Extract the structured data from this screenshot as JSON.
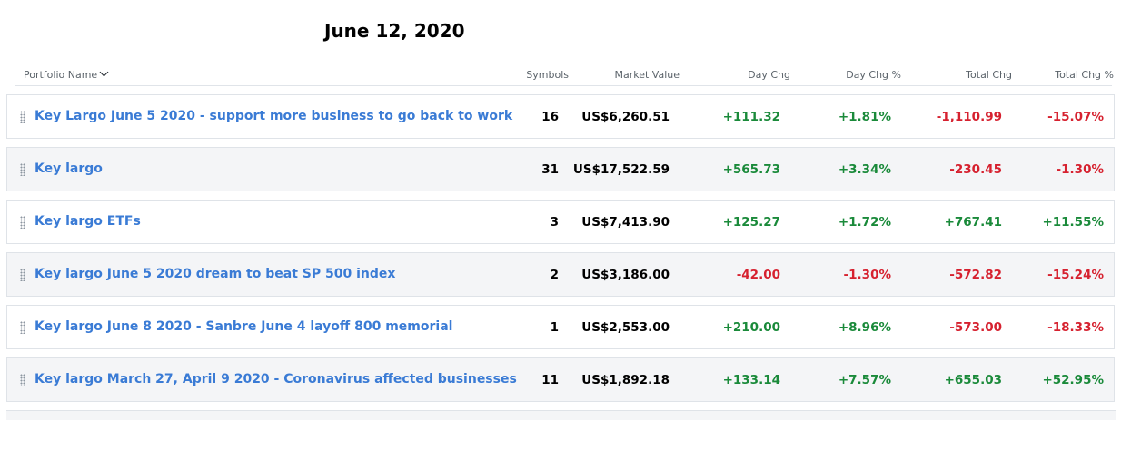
{
  "title": "June 12, 2020",
  "columns": {
    "name": "Portfolio Name",
    "symbols": "Symbols",
    "market_value": "Market Value",
    "day_chg": "Day Chg",
    "day_chg_pct": "Day Chg %",
    "total_chg": "Total Chg",
    "total_chg_pct": "Total Chg %"
  },
  "colors": {
    "positive": "#1a8a3a",
    "negative": "#d6212f",
    "link": "#3a7bd5"
  },
  "portfolios": [
    {
      "name": "Key Largo June 5 2020 - support more business to go back to work",
      "symbols": "16",
      "market_value": "US$6,260.51",
      "day_chg": "+111.32",
      "day_chg_pct": "+1.81%",
      "total_chg": "-1,110.99",
      "total_chg_pct": "-15.07%"
    },
    {
      "name": "Key largo",
      "symbols": "31",
      "market_value": "US$17,522.59",
      "day_chg": "+565.73",
      "day_chg_pct": "+3.34%",
      "total_chg": "-230.45",
      "total_chg_pct": "-1.30%"
    },
    {
      "name": "Key largo ETFs",
      "symbols": "3",
      "market_value": "US$7,413.90",
      "day_chg": "+125.27",
      "day_chg_pct": "+1.72%",
      "total_chg": "+767.41",
      "total_chg_pct": "+11.55%"
    },
    {
      "name": "Key largo June 5 2020 dream to beat SP 500 index",
      "symbols": "2",
      "market_value": "US$3,186.00",
      "day_chg": "-42.00",
      "day_chg_pct": "-1.30%",
      "total_chg": "-572.82",
      "total_chg_pct": "-15.24%"
    },
    {
      "name": "Key largo June 8 2020 - Sanbre June 4 layoff 800 memorial",
      "symbols": "1",
      "market_value": "US$2,553.00",
      "day_chg": "+210.00",
      "day_chg_pct": "+8.96%",
      "total_chg": "-573.00",
      "total_chg_pct": "-18.33%"
    },
    {
      "name": "Key largo March 27, April 9 2020 - Coronavirus affected businesses",
      "symbols": "11",
      "market_value": "US$1,892.18",
      "day_chg": "+133.14",
      "day_chg_pct": "+7.57%",
      "total_chg": "+655.03",
      "total_chg_pct": "+52.95%"
    }
  ]
}
